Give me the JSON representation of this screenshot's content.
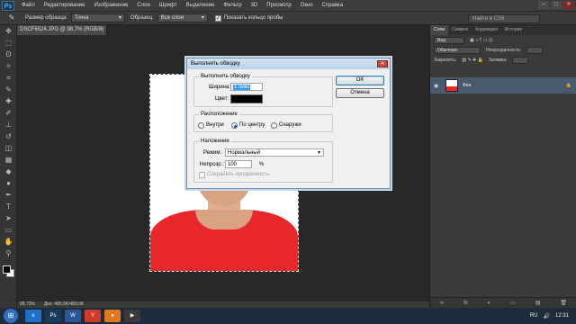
{
  "app": {
    "logo": "Ps",
    "menu": [
      "Файл",
      "Редактирование",
      "Изображение",
      "Слои",
      "Шрифт",
      "Выделение",
      "Фильтр",
      "3D",
      "Просмотр",
      "Окно",
      "Справка"
    ],
    "window_controls": [
      "–",
      "□",
      "✕"
    ]
  },
  "options_bar": {
    "sample_size_label": "Размер образца:",
    "sample_size_value": "Точка",
    "sample_label": "Образец:",
    "sample_value": "Все слои",
    "show_ring_label": "Показать кольцо пробы",
    "search_placeholder": "Найти в CS6"
  },
  "document": {
    "tab_title": "DSCF6524.JPG @ 98,7% (RGB/8)",
    "tab_close": "×",
    "zoom": "98,73%",
    "doc_size": "Док: 489,5K/489,5K"
  },
  "layers_panel": {
    "tabs": [
      "Слои",
      "Символ",
      "Коррекция",
      "История"
    ],
    "filter_label": "Вид",
    "blend_mode": "Обычные",
    "opacity_label": "Непрозрачность:",
    "lock_label": "Закрепить:",
    "fill_label": "Заливка:",
    "layer_name": "Фон",
    "bottom_icons": [
      "∞",
      "fx",
      "◐",
      "▭",
      "▤",
      "🗑"
    ]
  },
  "dialog": {
    "title": "Выполнить обводку",
    "close": "✕",
    "stroke_group": "Выполнить обводку",
    "width_label": "Ширина:",
    "width_value": "1 пикс",
    "color_label": "Цвет:",
    "color_value": "#000000",
    "location_group": "Расположение",
    "location_options": [
      "Внутри",
      "По центру",
      "Снаружи"
    ],
    "location_selected": "По центру",
    "blending_group": "Наложение",
    "mode_label": "Режим:",
    "mode_value": "Нормальный",
    "opacity_label": "Непрозр.:",
    "opacity_value": "100",
    "opacity_unit": "%",
    "preserve_label": "Сохранить прозрачность",
    "ok_label": "OK",
    "cancel_label": "Отмена"
  },
  "taskbar": {
    "start": "⊞",
    "apps": [
      "e",
      "Ps",
      "W",
      "Y",
      "●",
      "▶"
    ],
    "tray_lang": "RU",
    "time": "12:31"
  }
}
